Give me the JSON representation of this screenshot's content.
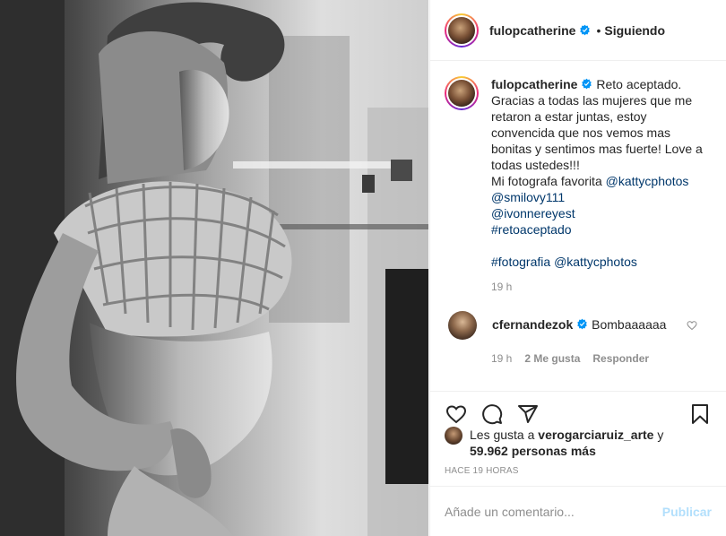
{
  "post": {
    "username": "fulopcatherine",
    "follow_status": "Siguiendo",
    "separator": "•"
  },
  "caption": {
    "username": "fulopcatherine",
    "lines": [
      "Reto aceptado.",
      "Gracias a todas las mujeres que me",
      "retaron a estar juntas, estoy",
      "convencida que nos vemos mas",
      "bonitas y sentimos mas fuerte! Love a",
      "todas ustedes!!!",
      "Mi fotografa favorita"
    ],
    "mention_1": "@kattycphotos",
    "mention_2": "@smilovy111",
    "mention_3": "@ivonnereyest",
    "hashtag_1": "#retoaceptado",
    "hashtag_2": "#fotografia",
    "mention_4": "@kattycphotos",
    "time": "19 h"
  },
  "comment": {
    "username": "cfernandezok",
    "text": "Bombaaaaaa",
    "time": "19 h",
    "likes": "2 Me gusta",
    "reply": "Responder"
  },
  "likes": {
    "prefix": "Les gusta a",
    "user": "verogarciaruiz_arte",
    "conj": "y",
    "count": "59.962 personas más"
  },
  "timestamp": "HACE 19 HORAS",
  "add_comment": {
    "placeholder": "Añade un comentario...",
    "publish": "Publicar"
  },
  "colors": {
    "link": "#00376b",
    "verified": "#0095f6",
    "muted": "#8e8e8e",
    "publish_disabled": "#b2dffc"
  },
  "icons": [
    "verified-badge-icon",
    "heart-icon",
    "comment-icon",
    "share-icon",
    "bookmark-icon"
  ]
}
